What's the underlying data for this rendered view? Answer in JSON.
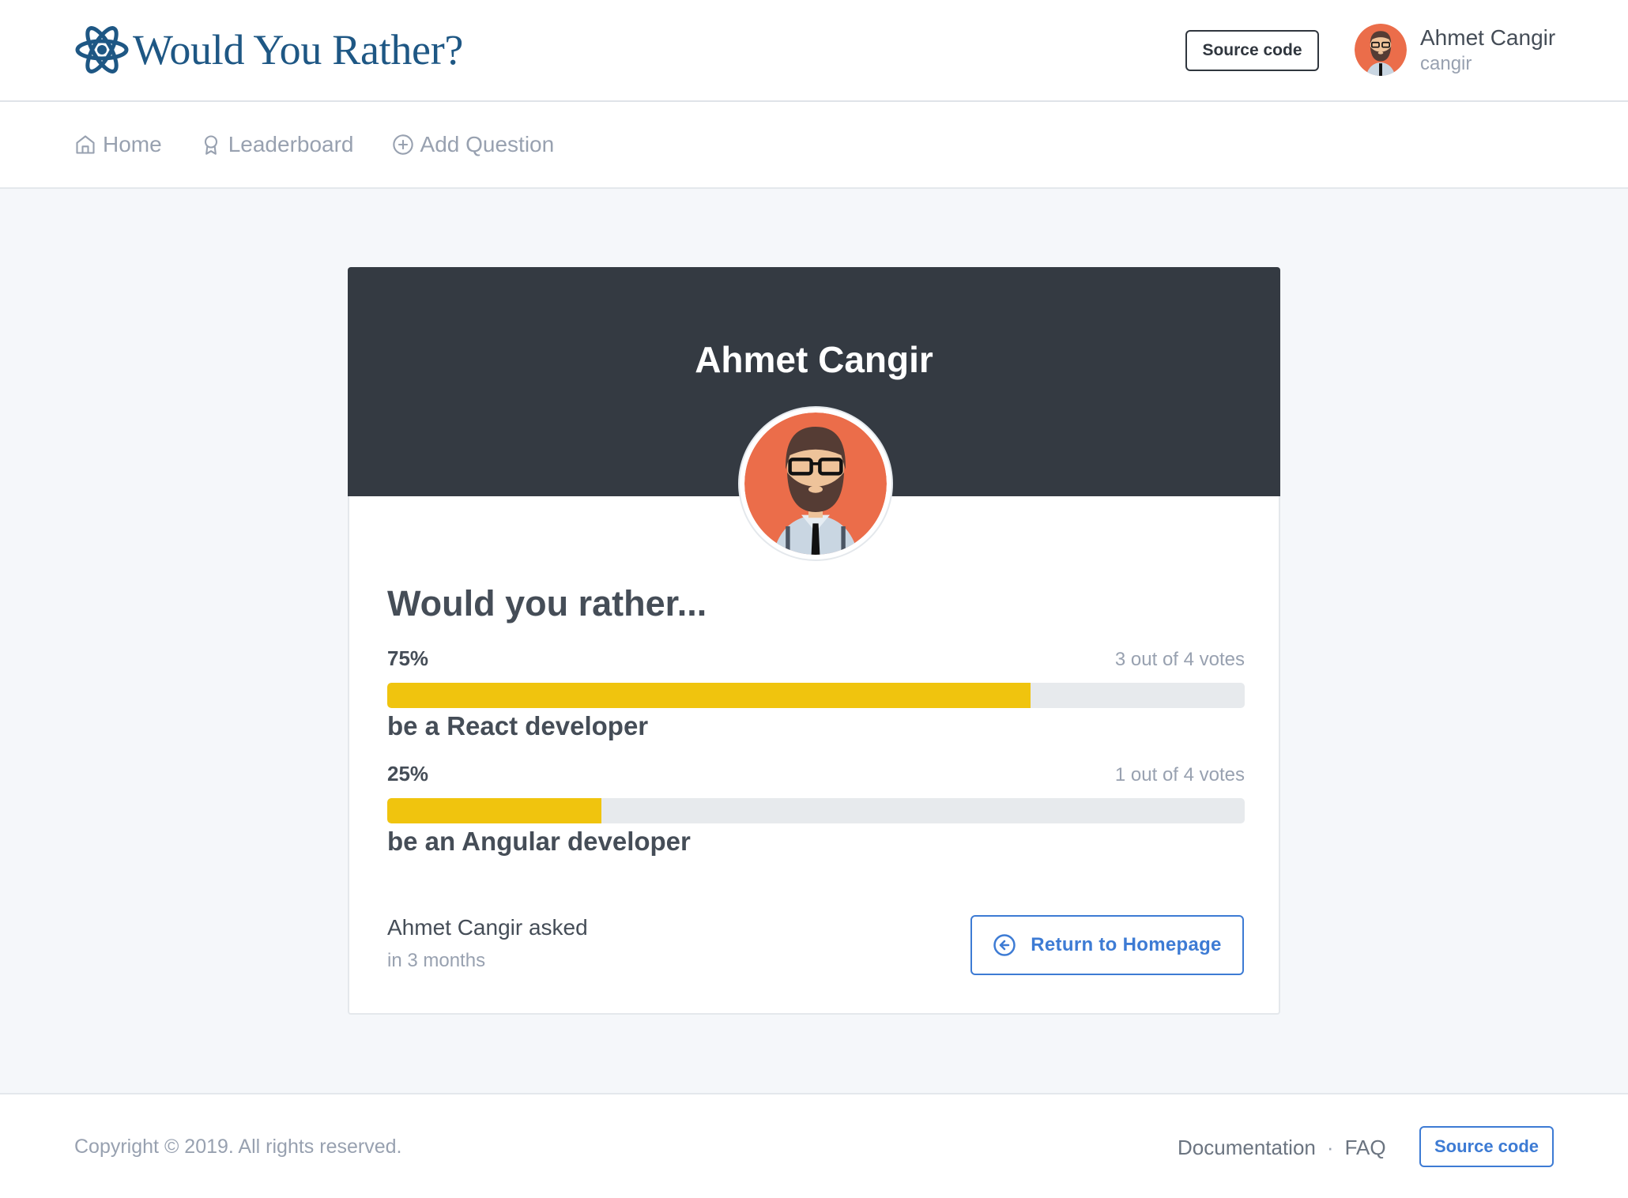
{
  "header": {
    "app_title": "Would You Rather?",
    "logo_icon": "atom-icon",
    "source_code_label": "Source code",
    "user": {
      "name": "Ahmet Cangir",
      "handle": "cangir",
      "avatar_icon": "bearded-man-avatar"
    }
  },
  "nav": {
    "items": [
      {
        "label": "Home",
        "icon": "home-icon"
      },
      {
        "label": "Leaderboard",
        "icon": "award-icon"
      },
      {
        "label": "Add Question",
        "icon": "plus-circle-icon"
      }
    ]
  },
  "poll": {
    "author_name": "Ahmet Cangir",
    "question": "Would you rather...",
    "options": [
      {
        "text": "be a React developer",
        "percent_label": "75%",
        "percent": 75,
        "votes_label": "3 out of 4 votes"
      },
      {
        "text": "be an Angular developer",
        "percent_label": "25%",
        "percent": 25,
        "votes_label": "1 out of 4 votes"
      }
    ],
    "asked_by": "Ahmet Cangir asked",
    "asked_when": "in 3 months",
    "return_label": "Return to Homepage",
    "return_icon": "arrow-left-circle-icon"
  },
  "footer": {
    "copyright": "Copyright © 2019. All rights reserved.",
    "links": [
      "Documentation",
      "FAQ"
    ],
    "separator": "·",
    "source_code_label": "Source code"
  },
  "colors": {
    "brand": "#1e5784",
    "card_header": "#343a42",
    "bar_fill": "#f0c40e",
    "bar_track": "#e7eaed",
    "accent_blue": "#3d7bd4",
    "avatar_bg": "#eb6d4a"
  }
}
